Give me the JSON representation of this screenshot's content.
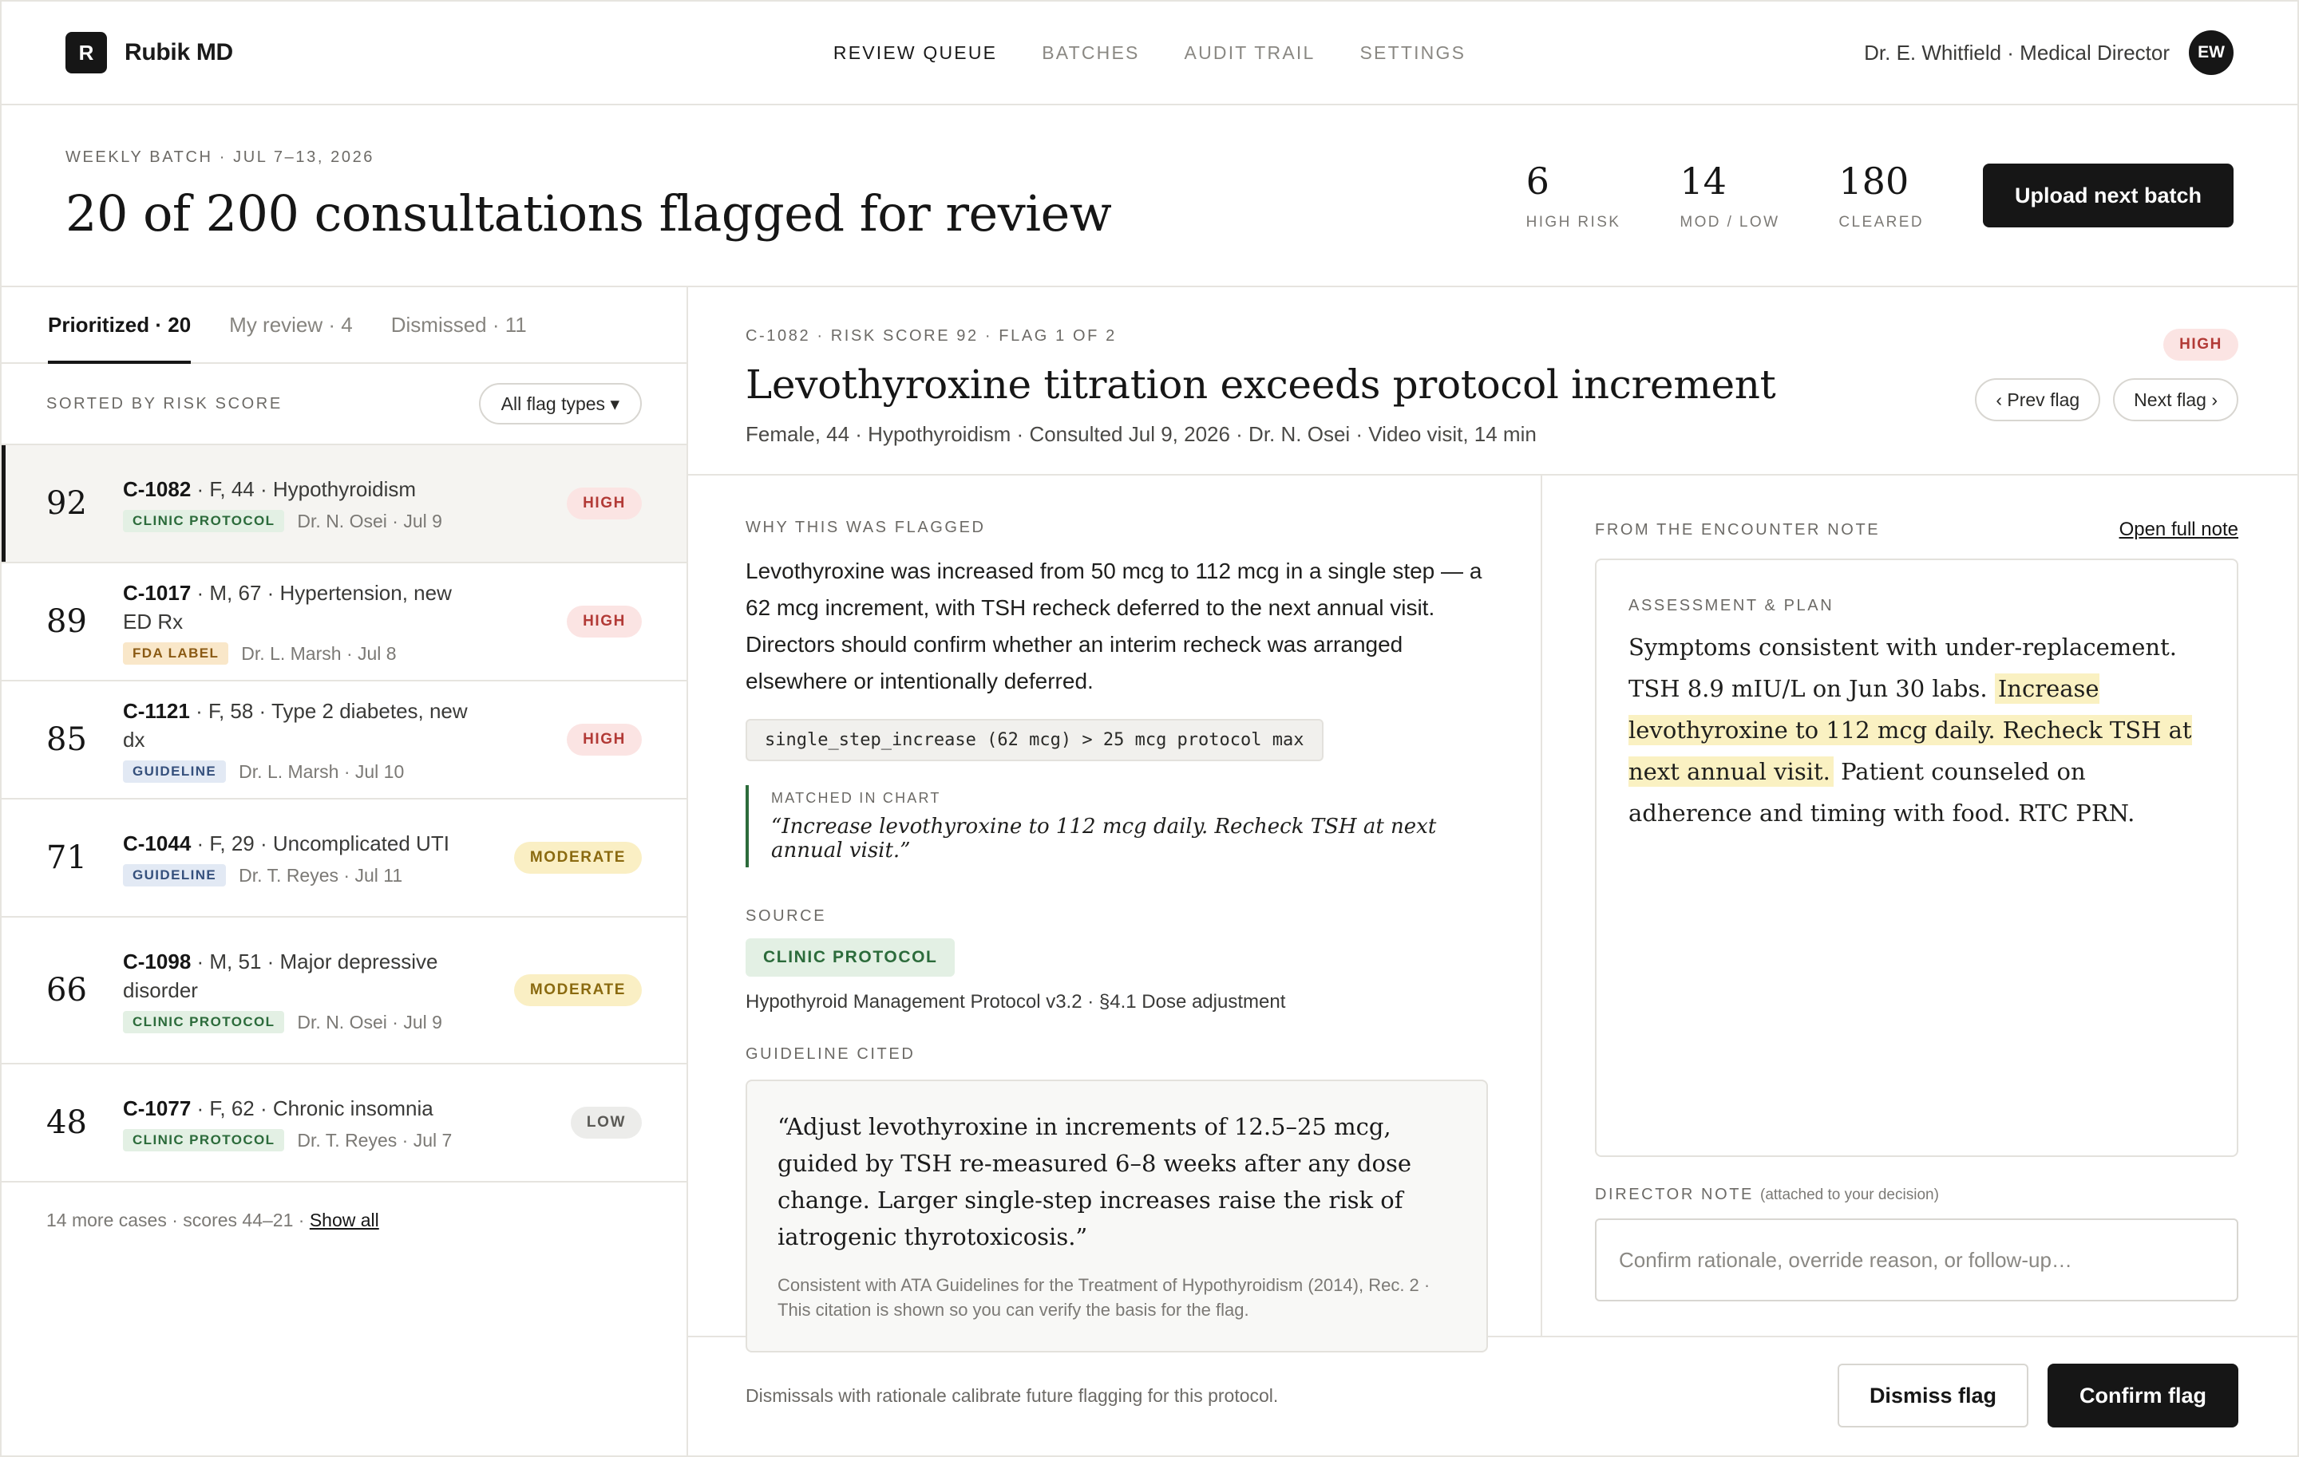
{
  "brand": {
    "logo_letter": "R",
    "name": "Rubik MD"
  },
  "nav": {
    "links": [
      "REVIEW QUEUE",
      "BATCHES",
      "AUDIT TRAIL",
      "SETTINGS"
    ],
    "active_index": 0
  },
  "user": {
    "label": "Dr. E. Whitfield · Medical Director",
    "initials": "EW"
  },
  "header": {
    "eyebrow": "WEEKLY BATCH · JUL 7–13, 2026",
    "title": "20 of 200 consultations flagged for review",
    "stats": [
      {
        "value": "6",
        "label": "HIGH RISK"
      },
      {
        "value": "14",
        "label": "MOD / LOW"
      },
      {
        "value": "180",
        "label": "CLEARED"
      }
    ],
    "upload_label": "Upload next batch"
  },
  "queue": {
    "tabs": [
      {
        "label": "Prioritized · 20",
        "active": true
      },
      {
        "label": "My review · 4",
        "active": false
      },
      {
        "label": "Dismissed · 11",
        "active": false
      }
    ],
    "sort_label": "SORTED BY RISK SCORE",
    "filter_label": "All flag types ▾",
    "cases": [
      {
        "score": "92",
        "id": "C-1082",
        "desc": " · F, 44 · Hypothyroidism",
        "tag": "CLINIC PROTOCOL",
        "tag_type": "protocol",
        "meta": "Dr. N. Osei · Jul 9",
        "risk": "HIGH",
        "risk_type": "high",
        "selected": true
      },
      {
        "score": "89",
        "id": "C-1017",
        "desc": " · M, 67 · Hypertension, new ED Rx",
        "tag": "FDA LABEL",
        "tag_type": "fda",
        "meta": "Dr. L. Marsh · Jul 8",
        "risk": "HIGH",
        "risk_type": "high",
        "selected": false
      },
      {
        "score": "85",
        "id": "C-1121",
        "desc": " · F, 58 · Type 2 diabetes, new dx",
        "tag": "GUIDELINE",
        "tag_type": "guideline",
        "meta": "Dr. L. Marsh · Jul 10",
        "risk": "HIGH",
        "risk_type": "high",
        "selected": false
      },
      {
        "score": "71",
        "id": "C-1044",
        "desc": " · F, 29 · Uncomplicated UTI",
        "tag": "GUIDELINE",
        "tag_type": "guideline",
        "meta": "Dr. T. Reyes · Jul 11",
        "risk": "MODERATE",
        "risk_type": "moderate",
        "selected": false
      },
      {
        "score": "66",
        "id": "C-1098",
        "desc": " · M, 51 · Major depressive disorder",
        "tag": "CLINIC PROTOCOL",
        "tag_type": "protocol",
        "meta": "Dr. N. Osei · Jul 9",
        "risk": "MODERATE",
        "risk_type": "moderate",
        "selected": false,
        "tall": true
      },
      {
        "score": "48",
        "id": "C-1077",
        "desc": " · F, 62 · Chronic insomnia",
        "tag": "CLINIC PROTOCOL",
        "tag_type": "protocol",
        "meta": "Dr. T. Reyes · Jul 7",
        "risk": "LOW",
        "risk_type": "low",
        "selected": false
      }
    ],
    "more_text": "14 more cases · scores 44–21 · ",
    "show_all": "Show all"
  },
  "detail": {
    "meta": "C-1082 · RISK SCORE 92 · FLAG 1 OF 2",
    "title": "Levothyroxine titration exceeds protocol increment",
    "subtitle": "Female, 44 · Hypothyroidism · Consulted Jul 9, 2026 · Dr. N. Osei · Video visit, 14 min",
    "risk": "HIGH",
    "prev_label": "‹ Prev flag",
    "next_label": "Next flag ›",
    "why_label": "WHY THIS WAS FLAGGED",
    "why_text": "Levothyroxine was increased from 50 mcg to 112 mcg in a single step — a 62 mcg increment, with TSH recheck deferred to the next annual visit. Directors should confirm whether an interim recheck was arranged elsewhere or intentionally deferred.",
    "rule": "single_step_increase (62 mcg) > 25 mcg protocol max",
    "matched_label": "MATCHED IN CHART",
    "matched_quote": "“Increase levothyroxine to 112 mcg daily. Recheck TSH at next annual visit.”",
    "source_label": "SOURCE",
    "source_chip": "CLINIC PROTOCOL",
    "source_name": "Hypothyroid Management Protocol v3.2 · §4.1 Dose adjustment",
    "guideline_label": "GUIDELINE CITED",
    "guideline_quote": "“Adjust levothyroxine in increments of 12.5–25 mcg, guided by TSH re-measured 6–8 weeks after any dose change. Larger single-step increases raise the risk of iatrogenic thyrotoxicosis.”",
    "guideline_cite": "Consistent with ATA Guidelines for the Treatment of Hypothyroidism (2014), Rec. 2 · This citation is shown so you can verify the basis for the flag.",
    "note_label": "FROM THE ENCOUNTER NOTE",
    "open_note": "Open full note",
    "note_section": "ASSESSMENT & PLAN",
    "note_pre": "Symptoms consistent with under-replacement. TSH 8.9 mIU/L on Jun 30 labs. ",
    "note_highlight": "Increase levothyroxine to 112 mcg daily. Recheck TSH at next annual visit.",
    "note_post": " Patient counseled on adherence and timing with food. RTC PRN.",
    "director_label": "DIRECTOR NOTE",
    "director_hint": "(attached to your decision)",
    "director_placeholder": "Confirm rationale, override reason, or follow-up…"
  },
  "footer": {
    "text": "Dismissals with rationale calibrate future flagging for this protocol.",
    "dismiss_label": "Dismiss flag",
    "confirm_label": "Confirm flag"
  },
  "colors": {
    "ink": "#161616",
    "risk_high": "#b23a36",
    "risk_moderate": "#8a6a10",
    "protocol_green": "#2c6b3b",
    "highlight": "#faf1c2"
  }
}
